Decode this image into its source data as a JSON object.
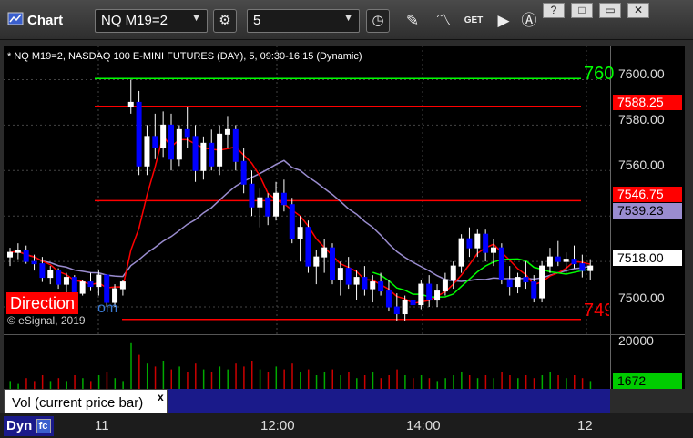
{
  "toolbar": {
    "title": "Chart",
    "symbol": "NQ M19=2",
    "interval": "5",
    "get_label": "GET",
    "window_buttons": [
      "?",
      "□",
      "▭",
      "✕"
    ]
  },
  "chart_header": "* NQ M19=2, NASDAQ 100 E-MINI FUTURES (DAY), 5, 09:30-16:15 (Dynamic)",
  "copyright": "© eSignal, 2019",
  "overlay": {
    "direction": "Direction",
    "suffix": "om"
  },
  "price_axis": {
    "ticks": [
      "7600.00",
      "7580.00",
      "7560.00",
      "7500.00"
    ],
    "tags": [
      {
        "value": "7588.25",
        "bg": "#ff0000",
        "fg": "#ffffff"
      },
      {
        "value": "7546.75",
        "bg": "#ff0000",
        "fg": "#ffffff"
      },
      {
        "value": "7539.23",
        "bg": "#9a8ccf",
        "fg": "#000000"
      },
      {
        "value": "7518.00",
        "bg": "#ffffff",
        "fg": "#000000"
      }
    ],
    "edge_labels": [
      "760",
      "749"
    ]
  },
  "vol_axis": {
    "top_tick": "20000",
    "current": "1672"
  },
  "study": {
    "label": "Vol (current price bar)",
    "close": "x"
  },
  "time_axis": {
    "tab": "Dyn",
    "labels": [
      "11",
      "12:00",
      "14:00",
      "12"
    ]
  },
  "colors": {
    "up": "#0000ff",
    "down": "#0000ff",
    "wick": "#ffffff",
    "fast_ma": "#ff0000",
    "slow_ma": "#9a8ccf",
    "green_ma": "#00ff00",
    "level": "#ff0000"
  },
  "chart_data": {
    "type": "candlestick",
    "ylim": [
      7488,
      7615
    ],
    "levels": [
      {
        "price": 7600.5,
        "color": "#00ff00"
      },
      {
        "price": 7588.25,
        "color": "#ff0000"
      },
      {
        "price": 7546.75,
        "color": "#ff0000"
      },
      {
        "price": 7494.5,
        "color": "#ff0000"
      }
    ],
    "candles": [
      [
        7522,
        7526,
        7518,
        7524
      ],
      [
        7524,
        7528,
        7521,
        7525
      ],
      [
        7525,
        7527,
        7519,
        7520
      ],
      [
        7520,
        7523,
        7516,
        7519
      ],
      [
        7519,
        7522,
        7511,
        7513
      ],
      [
        7513,
        7518,
        7510,
        7516
      ],
      [
        7516,
        7517,
        7508,
        7510
      ],
      [
        7510,
        7515,
        7506,
        7513
      ],
      [
        7513,
        7514,
        7504,
        7506
      ],
      [
        7506,
        7512,
        7505,
        7511
      ],
      [
        7511,
        7515,
        7507,
        7509
      ],
      [
        7509,
        7516,
        7505,
        7514
      ],
      [
        7514,
        7514,
        7500,
        7502
      ],
      [
        7502,
        7510,
        7500,
        7508
      ],
      [
        7508,
        7512,
        7505,
        7511
      ],
      [
        7588,
        7600,
        7585,
        7590
      ],
      [
        7590,
        7595,
        7558,
        7562
      ],
      [
        7562,
        7580,
        7558,
        7575
      ],
      [
        7575,
        7585,
        7565,
        7570
      ],
      [
        7570,
        7586,
        7566,
        7580
      ],
      [
        7580,
        7585,
        7560,
        7565
      ],
      [
        7565,
        7580,
        7562,
        7578
      ],
      [
        7578,
        7588,
        7570,
        7575
      ],
      [
        7575,
        7580,
        7555,
        7560
      ],
      [
        7560,
        7575,
        7556,
        7572
      ],
      [
        7572,
        7578,
        7560,
        7562
      ],
      [
        7562,
        7580,
        7558,
        7576
      ],
      [
        7576,
        7584,
        7570,
        7578
      ],
      [
        7578,
        7580,
        7560,
        7564
      ],
      [
        7564,
        7570,
        7550,
        7554
      ],
      [
        7554,
        7560,
        7540,
        7544
      ],
      [
        7544,
        7552,
        7535,
        7548
      ],
      [
        7548,
        7550,
        7536,
        7540
      ],
      [
        7540,
        7555,
        7538,
        7550
      ],
      [
        7550,
        7556,
        7542,
        7545
      ],
      [
        7545,
        7548,
        7528,
        7530
      ],
      [
        7530,
        7540,
        7520,
        7535
      ],
      [
        7535,
        7538,
        7515,
        7518
      ],
      [
        7518,
        7525,
        7510,
        7522
      ],
      [
        7522,
        7530,
        7515,
        7526
      ],
      [
        7526,
        7528,
        7510,
        7512
      ],
      [
        7512,
        7520,
        7505,
        7517
      ],
      [
        7517,
        7522,
        7508,
        7510
      ],
      [
        7510,
        7516,
        7503,
        7513
      ],
      [
        7513,
        7518,
        7505,
        7508
      ],
      [
        7508,
        7514,
        7502,
        7511
      ],
      [
        7511,
        7515,
        7505,
        7507
      ],
      [
        7507,
        7512,
        7498,
        7500
      ],
      [
        7500,
        7506,
        7494,
        7497
      ],
      [
        7497,
        7505,
        7494,
        7503
      ],
      [
        7503,
        7508,
        7498,
        7501
      ],
      [
        7501,
        7512,
        7499,
        7510
      ],
      [
        7510,
        7514,
        7500,
        7503
      ],
      [
        7503,
        7510,
        7500,
        7507
      ],
      [
        7507,
        7515,
        7505,
        7512
      ],
      [
        7512,
        7520,
        7508,
        7518
      ],
      [
        7518,
        7532,
        7515,
        7530
      ],
      [
        7530,
        7535,
        7522,
        7526
      ],
      [
        7526,
        7534,
        7522,
        7532
      ],
      [
        7532,
        7534,
        7520,
        7524
      ],
      [
        7524,
        7530,
        7518,
        7526
      ],
      [
        7526,
        7528,
        7510,
        7512
      ],
      [
        7512,
        7518,
        7505,
        7509
      ],
      [
        7509,
        7515,
        7506,
        7513
      ],
      [
        7513,
        7520,
        7508,
        7511
      ],
      [
        7511,
        7514,
        7502,
        7504
      ],
      [
        7504,
        7520,
        7502,
        7518
      ],
      [
        7518,
        7526,
        7515,
        7522
      ],
      [
        7522,
        7529,
        7518,
        7520
      ],
      [
        7520,
        7524,
        7515,
        7521
      ],
      [
        7521,
        7527,
        7517,
        7519
      ],
      [
        7519,
        7523,
        7513,
        7516
      ],
      [
        7516,
        7521,
        7512,
        7518
      ]
    ],
    "volume": [
      3,
      2,
      4,
      3,
      5,
      3,
      4,
      3,
      5,
      4,
      3,
      5,
      6,
      4,
      3,
      16,
      12,
      9,
      8,
      10,
      7,
      8,
      6,
      9,
      7,
      6,
      8,
      7,
      9,
      8,
      10,
      7,
      6,
      8,
      7,
      9,
      6,
      7,
      5,
      6,
      7,
      5,
      6,
      4,
      5,
      6,
      4,
      5,
      7,
      5,
      4,
      5,
      4,
      3,
      4,
      5,
      6,
      5,
      4,
      5,
      4,
      6,
      5,
      4,
      5,
      4,
      5,
      6,
      5,
      4,
      5,
      4,
      3
    ]
  }
}
